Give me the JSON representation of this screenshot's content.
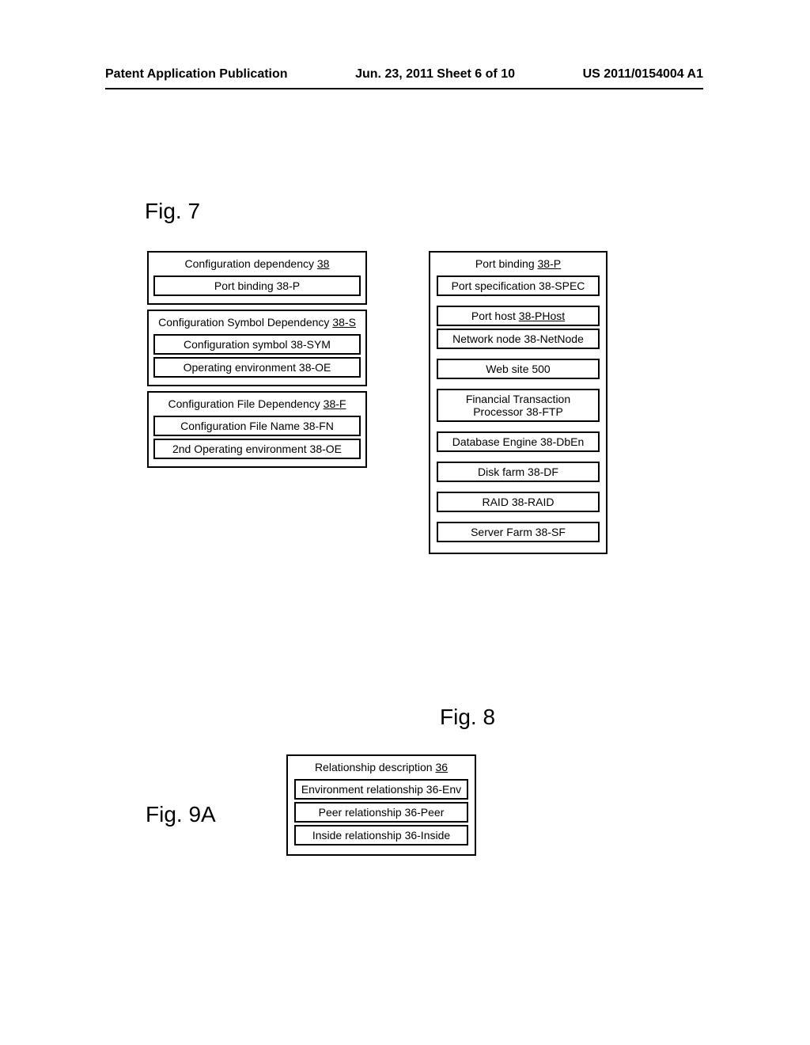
{
  "header": {
    "left": "Patent Application Publication",
    "center": "Jun. 23, 2011 Sheet 6 of 10",
    "right": "US 2011/0154004 A1"
  },
  "fig7": {
    "label": "Fig. 7",
    "groups": [
      {
        "title_parts": [
          {
            "text": "Configuration dependency ",
            "underline": false
          },
          {
            "text": "38",
            "underline": true
          }
        ],
        "items": [
          {
            "text": "Port binding 38-P"
          }
        ]
      },
      {
        "title_parts": [
          {
            "text": "Configuration Symbol Dependency ",
            "underline": false
          },
          {
            "text": "38-S",
            "underline": true
          }
        ],
        "items": [
          {
            "text": "Configuration symbol 38-SYM"
          },
          {
            "text": "Operating environment 38-OE"
          }
        ]
      },
      {
        "title_parts": [
          {
            "text": "Configuration File Dependency ",
            "underline": false
          },
          {
            "text": "38-F",
            "underline": true
          }
        ],
        "items": [
          {
            "text": "Configuration File Name 38-FN"
          },
          {
            "text": "2nd Operating environment 38-OE"
          }
        ]
      }
    ]
  },
  "fig8": {
    "label": "Fig. 8",
    "title_parts": [
      {
        "text": "Port binding ",
        "underline": false
      },
      {
        "text": "38-P",
        "underline": true
      }
    ],
    "items": [
      {
        "text": "Port specification 38-SPEC"
      },
      {
        "text_parts": [
          {
            "text": "Port host ",
            "underline": false
          },
          {
            "text": "38-PHost",
            "underline": true
          }
        ]
      },
      {
        "text": "Network node 38-NetNode"
      },
      {
        "text": "Web site 500"
      },
      {
        "text": "Financial Transaction Processor 38-FTP"
      },
      {
        "text": "Database Engine 38-DbEn"
      },
      {
        "text": "Disk farm 38-DF"
      },
      {
        "text": "RAID 38-RAID"
      },
      {
        "text": "Server Farm 38-SF"
      }
    ]
  },
  "fig9a": {
    "label": "Fig. 9A",
    "title_parts": [
      {
        "text": "Relationship description ",
        "underline": false
      },
      {
        "text": "36",
        "underline": true
      }
    ],
    "items": [
      {
        "text": "Environment relationship 36-Env"
      },
      {
        "text": "Peer relationship 36-Peer"
      },
      {
        "text": "Inside relationship 36-Inside"
      }
    ]
  }
}
